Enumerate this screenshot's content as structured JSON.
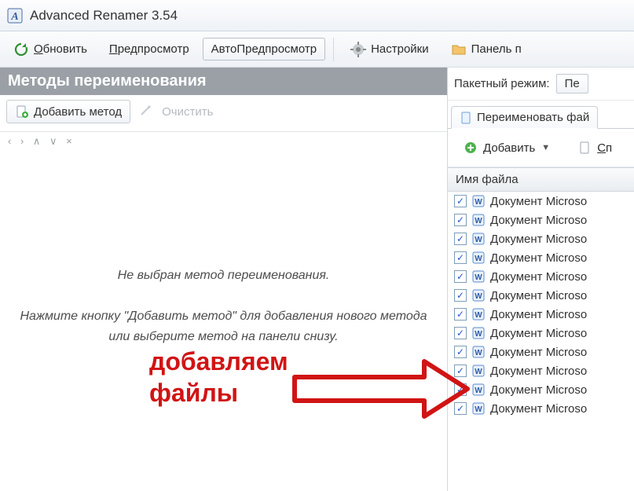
{
  "window": {
    "title": "Advanced Renamer 3.54"
  },
  "menubar": {
    "refresh": "Обновить",
    "preview": "Предпросмотр",
    "autopreview": "АвтоПредпросмотр",
    "settings": "Настройки",
    "panel": "Панель п"
  },
  "methods": {
    "header": "Методы переименования",
    "add_method": "Добавить метод",
    "clear": "Очистить",
    "placeholder1": "Не выбран метод переименования.",
    "placeholder2": "Нажмите кнопку \"Добавить метод\" для добавления нового метода или выберите метод на панели снизу."
  },
  "right": {
    "batch_mode_label": "Пакетный режим:",
    "batch_mode_value": "Пе",
    "tab_rename": "Переименовать фай",
    "add": "Добавить",
    "clear_short": "Сп",
    "column_filename": "Имя файла",
    "files": [
      "Документ Microso",
      "Документ Microso",
      "Документ Microso",
      "Документ Microso",
      "Документ Microso",
      "Документ Microso",
      "Документ Microso",
      "Документ Microso",
      "Документ Microso",
      "Документ Microso",
      "Документ Microso",
      "Документ Microso"
    ]
  },
  "annotation": {
    "line1": "добавляем",
    "line2": "файлы"
  }
}
